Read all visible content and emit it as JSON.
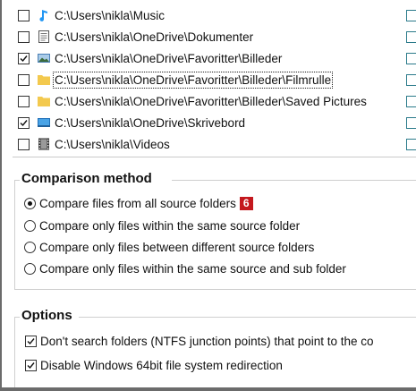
{
  "folders": [
    {
      "path": "C:\\Users\\nikla\\Music",
      "checked": false,
      "icon": "music-note-icon"
    },
    {
      "path": "C:\\Users\\nikla\\OneDrive\\Dokumenter",
      "checked": false,
      "icon": "document-folder-icon"
    },
    {
      "path": "C:\\Users\\nikla\\OneDrive\\Favoritter\\Billeder",
      "checked": true,
      "icon": "pictures-folder-icon"
    },
    {
      "path": "C:\\Users\\nikla\\OneDrive\\Favoritter\\Billeder\\Filmrulle",
      "checked": false,
      "icon": "folder-icon",
      "focused": true
    },
    {
      "path": "C:\\Users\\nikla\\OneDrive\\Favoritter\\Billeder\\Saved Pictures",
      "checked": false,
      "icon": "folder-icon"
    },
    {
      "path": "C:\\Users\\nikla\\OneDrive\\Skrivebord",
      "checked": true,
      "icon": "desktop-folder-icon"
    },
    {
      "path": "C:\\Users\\nikla\\Videos",
      "checked": false,
      "icon": "video-folder-icon"
    }
  ],
  "comparison": {
    "title": "Comparison method",
    "badge": "6",
    "selected_index": 0,
    "options": [
      "Compare files from all source folders",
      "Compare only files within the same source folder",
      "Compare only files between different source folders",
      "Compare only files within the same source and sub folder"
    ]
  },
  "options": {
    "title": "Options",
    "items": [
      {
        "label": "Don't search folders (NTFS junction points) that point to the co",
        "checked": true
      },
      {
        "label": "Disable Windows 64bit file system redirection",
        "checked": true
      }
    ]
  },
  "colors": {
    "badge": "#c4181e",
    "folder_yellow": "#f3c94e",
    "accent": "#2a7a8a"
  }
}
